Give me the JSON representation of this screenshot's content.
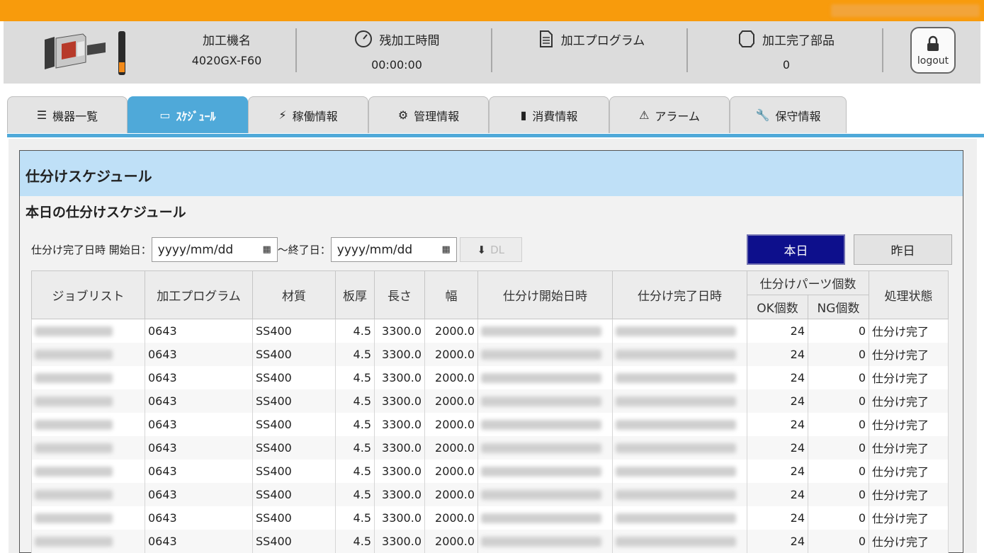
{
  "header": {
    "machine_name_label": "加工機名",
    "machine_name_value": "4020GX-F60",
    "remaining_time_label": "残加工時間",
    "remaining_time_value": "00:00:00",
    "program_label": "加工プログラム",
    "program_value": "",
    "completed_parts_label": "加工完了部品",
    "completed_parts_value": "0",
    "logout_label": "logout"
  },
  "tabs": [
    {
      "label": "機器一覧",
      "icon": "list-icon"
    },
    {
      "label": "ｽｹｼﾞｭｰﾙ",
      "icon": "calendar-icon",
      "active": true
    },
    {
      "label": "稼働情報",
      "icon": "bolt-icon"
    },
    {
      "label": "管理情報",
      "icon": "gear-icon"
    },
    {
      "label": "消費情報",
      "icon": "battery-icon"
    },
    {
      "label": "アラーム",
      "icon": "warning-icon"
    },
    {
      "label": "保守情報",
      "icon": "wrench-icon"
    }
  ],
  "panel": {
    "title": "仕分けスケジュール",
    "subtitle": "本日の仕分けスケジュール"
  },
  "filter": {
    "start_label": "仕分け完了日時 開始日：",
    "start_placeholder": "yyyy/mm/dd",
    "end_label": "～終了日：",
    "end_placeholder": "yyyy/mm/dd",
    "download_label": "DL",
    "today_label": "本日",
    "yesterday_label": "昨日"
  },
  "table": {
    "headers": {
      "job_list": "ジョブリスト",
      "program": "加工プログラム",
      "material": "材質",
      "thickness": "板厚",
      "length": "長さ",
      "width": "幅",
      "start_time": "仕分け開始日時",
      "end_time": "仕分け完了日時",
      "parts_count": "仕分けパーツ個数",
      "ok_count": "OK個数",
      "ng_count": "NG個数",
      "status": "処理状態"
    },
    "rows": [
      {
        "program": "0643",
        "material": "SS400",
        "thickness": "4.5",
        "length": "3300.0",
        "width": "2000.0",
        "ok": "24",
        "ng": "0",
        "status": "仕分け完了"
      },
      {
        "program": "0643",
        "material": "SS400",
        "thickness": "4.5",
        "length": "3300.0",
        "width": "2000.0",
        "ok": "24",
        "ng": "0",
        "status": "仕分け完了"
      },
      {
        "program": "0643",
        "material": "SS400",
        "thickness": "4.5",
        "length": "3300.0",
        "width": "2000.0",
        "ok": "24",
        "ng": "0",
        "status": "仕分け完了"
      },
      {
        "program": "0643",
        "material": "SS400",
        "thickness": "4.5",
        "length": "3300.0",
        "width": "2000.0",
        "ok": "24",
        "ng": "0",
        "status": "仕分け完了"
      },
      {
        "program": "0643",
        "material": "SS400",
        "thickness": "4.5",
        "length": "3300.0",
        "width": "2000.0",
        "ok": "24",
        "ng": "0",
        "status": "仕分け完了"
      },
      {
        "program": "0643",
        "material": "SS400",
        "thickness": "4.5",
        "length": "3300.0",
        "width": "2000.0",
        "ok": "24",
        "ng": "0",
        "status": "仕分け完了"
      },
      {
        "program": "0643",
        "material": "SS400",
        "thickness": "4.5",
        "length": "3300.0",
        "width": "2000.0",
        "ok": "24",
        "ng": "0",
        "status": "仕分け完了"
      },
      {
        "program": "0643",
        "material": "SS400",
        "thickness": "4.5",
        "length": "3300.0",
        "width": "2000.0",
        "ok": "24",
        "ng": "0",
        "status": "仕分け完了"
      },
      {
        "program": "0643",
        "material": "SS400",
        "thickness": "4.5",
        "length": "3300.0",
        "width": "2000.0",
        "ok": "24",
        "ng": "0",
        "status": "仕分け完了"
      },
      {
        "program": "0643",
        "material": "SS400",
        "thickness": "4.5",
        "length": "3300.0",
        "width": "2000.0",
        "ok": "24",
        "ng": "0",
        "status": "仕分け完了"
      }
    ]
  },
  "colors": {
    "top_bar": "#f89b0c",
    "active_tab": "#4fa9d9",
    "panel_title_bg": "#bfe0f7",
    "today_button": "#0d0f8c"
  }
}
